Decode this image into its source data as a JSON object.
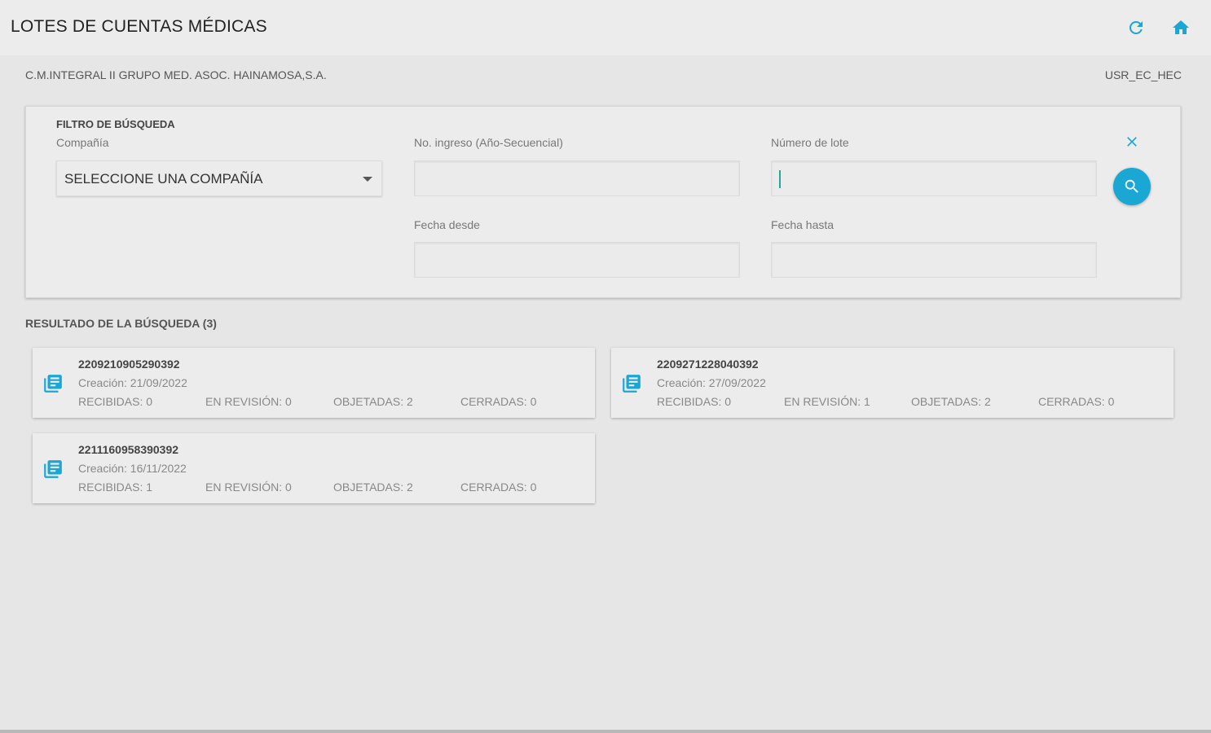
{
  "header": {
    "title": "LOTES DE CUENTAS MÉDICAS",
    "refresh_icon": "refresh-icon",
    "home_icon": "home-icon",
    "accent_color": "#1aa7d4"
  },
  "subheader": {
    "company": "C.M.INTEGRAL II GRUPO MED. ASOC. HAINAMOSA,S.A.",
    "user": "USR_EC_HEC"
  },
  "filter": {
    "title": "FILTRO DE BÚSQUEDA",
    "company_label": "Compañía",
    "company_value": "SELECCIONE UNA COMPAÑÍA",
    "ingreso_label": "No. ingreso (Año-Secuencial)",
    "ingreso_value": "",
    "lote_label": "Número de lote",
    "lote_value": "",
    "fecha_desde_label": "Fecha desde",
    "fecha_desde_value": "",
    "fecha_hasta_label": "Fecha hasta",
    "fecha_hasta_value": ""
  },
  "results": {
    "title": "RESULTADO DE LA BÚSQUEDA (3)",
    "items": [
      {
        "number": "2209210905290392",
        "created": "Creación: 21/09/2022",
        "recibidas": "RECIBIDAS: 0",
        "en_revision": "EN REVISIÓN: 0",
        "objetadas": "OBJETADAS: 2",
        "cerradas": "CERRADAS: 0"
      },
      {
        "number": "2209271228040392",
        "created": "Creación: 27/09/2022",
        "recibidas": "RECIBIDAS: 0",
        "en_revision": "EN REVISIÓN: 1",
        "objetadas": "OBJETADAS: 2",
        "cerradas": "CERRADAS: 0"
      },
      {
        "number": "2211160958390392",
        "created": "Creación: 16/11/2022",
        "recibidas": "RECIBIDAS: 1",
        "en_revision": "EN REVISIÓN: 0",
        "objetadas": "OBJETADAS: 2",
        "cerradas": "CERRADAS: 0"
      }
    ]
  }
}
